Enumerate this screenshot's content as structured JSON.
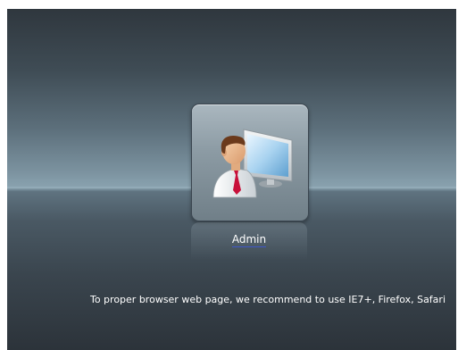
{
  "login": {
    "user_label": "Admin",
    "user_icon": "admin-computer-user-icon"
  },
  "footer": {
    "browser_notice": "To proper browser web page, we recommend to use IE7+, Firefox, Safari"
  },
  "colors": {
    "background_top": "#2f373e",
    "background_horizon": "#8aa3b0",
    "background_bottom": "#2c333a",
    "tile": "#8c9ba4",
    "link_underline": "#3d57c8",
    "text": "#ffffff"
  }
}
